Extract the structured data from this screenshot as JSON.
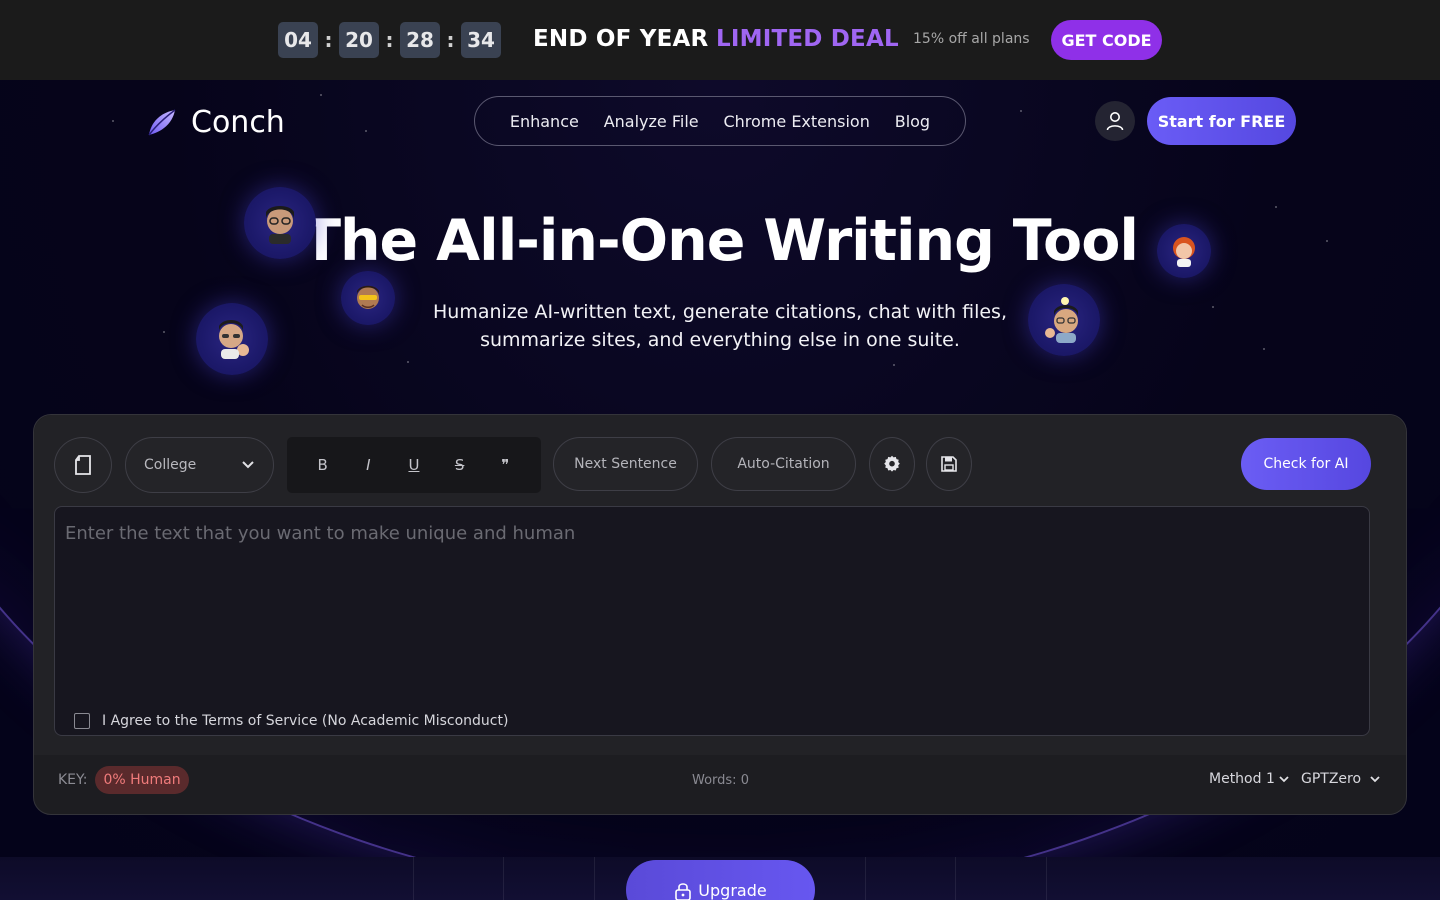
{
  "promo": {
    "timer": [
      "04",
      "20",
      "28",
      "34"
    ],
    "separator": ":",
    "headline": "END OF YEAR",
    "deal": "LIMITED DEAL",
    "offer": "15% off all plans",
    "cta": "GET CODE",
    "colors": {
      "deal": "#a066f2",
      "cta_bg": "#8f30e8"
    }
  },
  "header": {
    "brand": "Conch",
    "nav": [
      "Enhance",
      "Analyze File",
      "Chrome Extension",
      "Blog"
    ],
    "user_icon": "user-icon",
    "cta": "Start for FREE"
  },
  "hero": {
    "title": "The All-in-One Writing Tool",
    "subtitle": "Humanize AI-written text, generate citations, chat with files, summarize sites, and everything else in one suite."
  },
  "editor": {
    "doc_icon": "document-icon",
    "level_select": "College",
    "format_buttons": [
      "B",
      "I",
      "U",
      "S",
      "❞"
    ],
    "next_sentence": "Next Sentence",
    "auto_citation": "Auto-Citation",
    "settings_icon": "gear-icon",
    "save_icon": "save-icon",
    "check_ai": "Check for AI",
    "placeholder": "Enter the text that you want to make unique and human",
    "agree": "I Agree to the Terms of Service (No Academic Misconduct)",
    "key_label": "KEY:",
    "key_badge": "0% Human",
    "words": "Words: 0",
    "method": "Method 1",
    "detector": "GPTZero"
  },
  "bottom": {
    "upgrade": "Upgrade",
    "lock_icon": "lock-icon"
  },
  "colors": {
    "accent": "#6b5df4",
    "background": "#050317",
    "card": "#1d1d21"
  }
}
